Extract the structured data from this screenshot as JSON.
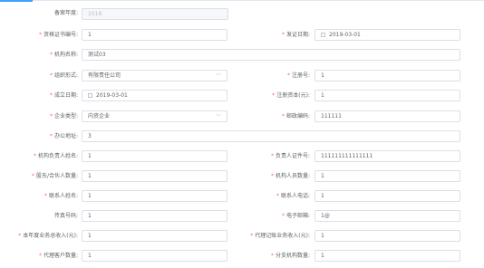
{
  "form": {
    "year": {
      "label": "备案年度:",
      "value": "2018"
    },
    "cert_no": {
      "label": "资格证书编号:",
      "value": "1"
    },
    "issue_date": {
      "label": "发证日期:",
      "value": "2019-03-01"
    },
    "org_name": {
      "label": "机构名称:",
      "value": "测试03"
    },
    "org_form": {
      "label": "组织形式:",
      "value": "有限责任公司"
    },
    "reg_no": {
      "label": "注册号:",
      "value": "1"
    },
    "found_date": {
      "label": "成立日期:",
      "value": "2019-03-01"
    },
    "reg_capital": {
      "label": "注册资本(元):",
      "value": "1"
    },
    "ent_type": {
      "label": "企业类型:",
      "value": "内资企业"
    },
    "postcode": {
      "label": "邮政编码:",
      "value": "111111"
    },
    "address": {
      "label": "办公地址:",
      "value": "3"
    },
    "leader_name": {
      "label": "机构负责人姓名:",
      "value": "1"
    },
    "leader_id": {
      "label": "负责人证件号:",
      "value": "111111111111111"
    },
    "partner_count": {
      "label": "股东/合伙人数量:",
      "value": "1"
    },
    "staff_count": {
      "label": "机构人员数量:",
      "value": "1"
    },
    "contact_name": {
      "label": "联系人姓名:",
      "value": "1"
    },
    "contact_phone": {
      "label": "联系人电话:",
      "value": "1"
    },
    "fax": {
      "label": "传真号码:",
      "value": "1"
    },
    "email": {
      "label": "电子邮箱:",
      "value": "1@"
    },
    "income": {
      "label": "本年度业务总收入(元):",
      "value": "1"
    },
    "agency_income": {
      "label": "代理记账业务收入(元):",
      "value": "1"
    },
    "client_count": {
      "label": "代理客户数量:",
      "value": "1"
    },
    "branch_count": {
      "label": "分支机构数量:",
      "value": "1"
    }
  },
  "required_mark": "*",
  "icons": {
    "calendar": "calendar-icon",
    "chevron": "chevron-down-icon"
  },
  "colors": {
    "accent": "#409eff",
    "required": "#f56c6c",
    "border": "#dcdfe6",
    "disabled_bg": "#f5f7fa"
  }
}
